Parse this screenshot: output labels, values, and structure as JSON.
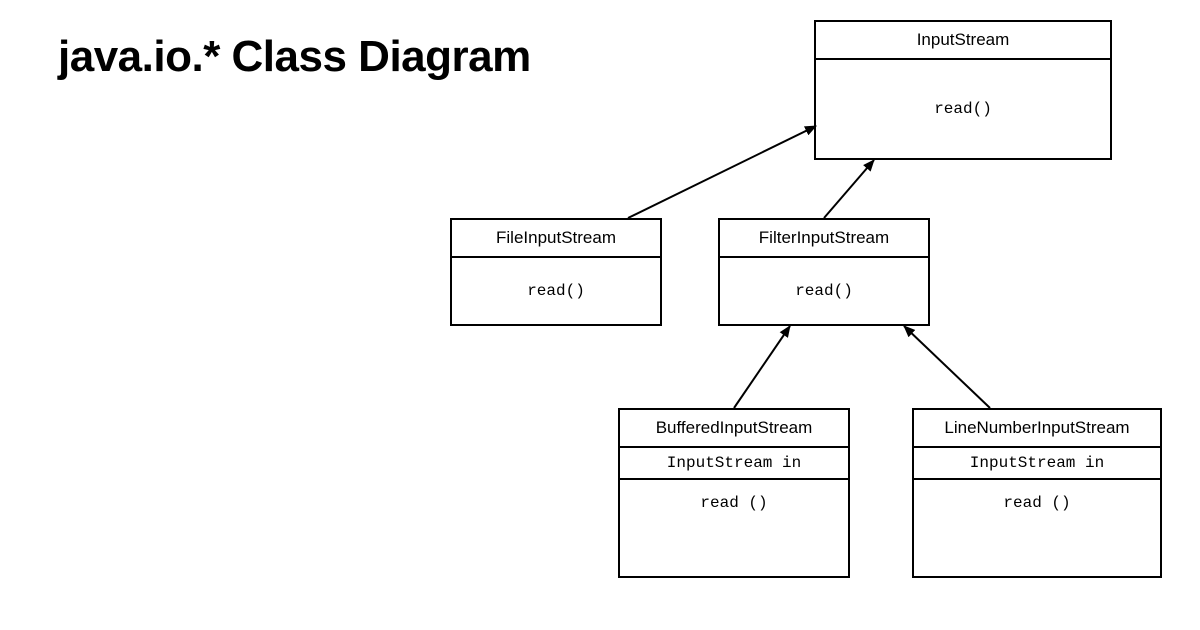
{
  "title": "java.io.* Class Diagram",
  "classes": {
    "inputstream": {
      "name": "InputStream",
      "method": "read()"
    },
    "fileinputstream": {
      "name": "FileInputStream",
      "method": "read()"
    },
    "filterinputstream": {
      "name": "FilterInputStream",
      "method": "read()"
    },
    "bufferedinputstream": {
      "name": "BufferedInputStream",
      "attr": "InputStream in",
      "method": "read ()"
    },
    "linenumberinputstream": {
      "name": "LineNumberInputStream",
      "attr": "InputStream in",
      "method": "read ()"
    }
  },
  "relationships": [
    {
      "from": "FileInputStream",
      "to": "InputStream",
      "type": "inherits"
    },
    {
      "from": "FilterInputStream",
      "to": "InputStream",
      "type": "inherits"
    },
    {
      "from": "BufferedInputStream",
      "to": "FilterInputStream",
      "type": "inherits"
    },
    {
      "from": "LineNumberInputStream",
      "to": "FilterInputStream",
      "type": "inherits"
    }
  ]
}
